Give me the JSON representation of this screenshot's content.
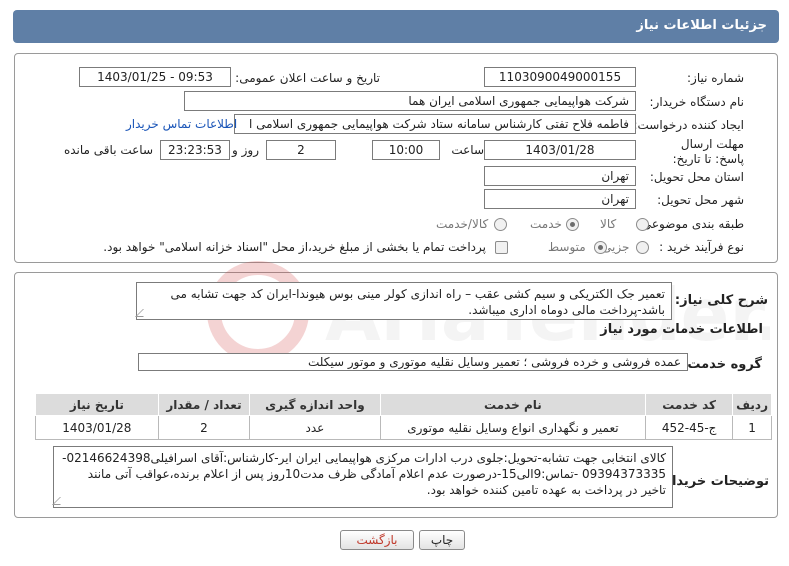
{
  "header": {
    "title": "جزئیات اطلاعات نیاز"
  },
  "form": {
    "need_number_label": "شماره نیاز:",
    "need_number": "1103090049000155",
    "announce_label": "تاریخ و ساعت اعلان عمومی:",
    "announce_value": "1403/01/25 - 09:53",
    "buyer_org_label": "نام دستگاه خریدار:",
    "buyer_org": "شرکت هواپیمایی جمهوری اسلامی ایران هما",
    "creator_label": "ایجاد کننده درخواست:",
    "creator": "فاطمه فلاح تفتی کارشناس سامانه ستاد شرکت هواپیمایی جمهوری اسلامی ا",
    "contact_link": "اطلاعات تماس خریدار",
    "deadline_label": "مهلت ارسال پاسخ: تا تاریخ:",
    "deadline_date": "1403/01/28",
    "time_label": "ساعت",
    "deadline_time": "10:00",
    "days_value": "2",
    "days_label": "روز و",
    "remaining_time": "23:23:53",
    "remaining_label": "ساعت باقی مانده",
    "province_label": "استان محل تحویل:",
    "province": "تهران",
    "city_label": "شهر محل تحویل:",
    "city": "تهران",
    "category_label": "طبقه بندی موضوعی:",
    "category_options": [
      "کالا",
      "خدمت",
      "کالا/خدمت"
    ],
    "process_label": "نوع فرآیند خرید :",
    "process_options": [
      "جزیی",
      "متوسط"
    ],
    "payment_note": "پرداخت تمام یا بخشی از مبلغ خرید،از محل \"اسناد خزانه اسلامی\" خواهد بود."
  },
  "details": {
    "summary_label": "شرح کلی نیاز:",
    "summary": "تعمیر جک الکتریکی و سیم کشی عقب – راه اندازی کولر مینی بوس هیوندا-ایران کد جهت تشابه می باشد-پرداخت مالی دوماه اداری میباشد.",
    "services_title": "اطلاعات خدمات مورد نیاز",
    "service_group_label": "گروه خدمت:",
    "service_group": "عمده فروشی و خرده فروشی ؛ تعمیر وسایل نقلیه موتوری و موتور سیکلت",
    "table": {
      "headers": [
        "ردیف",
        "کد خدمت",
        "نام خدمت",
        "واحد اندازه گیری",
        "تعداد / مقدار",
        "تاریخ نیاز"
      ],
      "rows": [
        [
          "1",
          "ج-45-452",
          "تعمیر و نگهداری انواع وسایل نقلیه موتوری",
          "عدد",
          "2",
          "1403/01/28"
        ]
      ]
    },
    "buyer_notes_label": "توضیحات خریدار:",
    "buyer_notes": "کالای انتخابی جهت تشابه-تحویل:جلوی درب ادارات مرکزی هواپیمایی ایران ایر-کارشناس:آقای اسرافیلی02146624398-09394373335 -تماس:9الی15-درصورت عدم اعلام آمادگی ظرف مدت10روز پس از اعلام برنده،عواقب آتی مانند تاخیر در پرداخت به عهده تامین کننده خواهد بود."
  },
  "buttons": {
    "print": "چاپ",
    "back": "بازگشت"
  },
  "watermark": {
    "text": "AriaTender.neT"
  },
  "colors": {
    "header_bg": "#5f7fa6",
    "link": "#1a55b8",
    "back_text": "#c0392b"
  }
}
